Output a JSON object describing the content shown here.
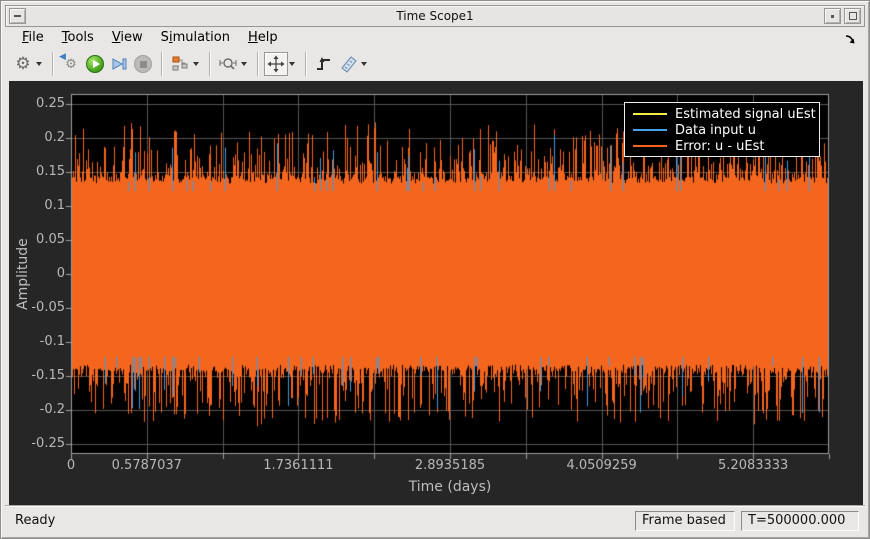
{
  "window": {
    "title": "Time Scope1"
  },
  "menubar": {
    "items": [
      {
        "pre": "",
        "mn": "F",
        "post": "ile"
      },
      {
        "pre": "",
        "mn": "T",
        "post": "ools"
      },
      {
        "pre": "",
        "mn": "V",
        "post": "iew"
      },
      {
        "pre": "S",
        "mn": "i",
        "post": "mulation"
      },
      {
        "pre": "",
        "mn": "H",
        "post": "elp"
      }
    ]
  },
  "toolbar": {
    "buttons": [
      "settings-gear",
      "connect-to-simulink",
      "run",
      "step-forward",
      "stop",
      "signal-selector",
      "zoom",
      "span-axes",
      "trigger",
      "measurements"
    ]
  },
  "chart_data": {
    "type": "line",
    "title": "",
    "xlabel": "Time (days)",
    "ylabel": "Amplitude",
    "xlim": [
      0,
      5.787037
    ],
    "ylim": [
      -0.2647,
      0.2647
    ],
    "grid": true,
    "background": "#000000",
    "grid_color": "#565656",
    "axis_color": "#9e9e9e",
    "tick_label_color": "#b8b8b8",
    "xticks": {
      "gridline_step": 0.5787037,
      "labels": [
        {
          "value": 0,
          "text": "0"
        },
        {
          "value": 0.5787037,
          "text": "0.5787037"
        },
        {
          "value": 1.7361111,
          "text": "1.7361111"
        },
        {
          "value": 2.8935185,
          "text": "2.8935185"
        },
        {
          "value": 4.0509259,
          "text": "4.0509259"
        },
        {
          "value": 5.2083333,
          "text": "5.2083333"
        }
      ]
    },
    "yticks": [
      {
        "value": 0.25,
        "text": "0.25"
      },
      {
        "value": 0.2,
        "text": "0.2"
      },
      {
        "value": 0.15,
        "text": "0.15"
      },
      {
        "value": 0.1,
        "text": "0.1"
      },
      {
        "value": 0.05,
        "text": "0.05"
      },
      {
        "value": 0,
        "text": "0"
      },
      {
        "value": -0.05,
        "text": "-0.05"
      },
      {
        "value": -0.1,
        "text": "-0.1"
      },
      {
        "value": -0.15,
        "text": "-0.15"
      },
      {
        "value": -0.2,
        "text": "-0.2"
      },
      {
        "value": -0.25,
        "text": "-0.25"
      }
    ],
    "legend": {
      "position": "northeast",
      "entries": [
        {
          "label": "Estimated signal uEst",
          "color": "#f2ee45"
        },
        {
          "label": "Data input u",
          "color": "#4aa0e8"
        },
        {
          "label": "Error: u - uEst",
          "color": "#f4661e"
        }
      ]
    },
    "series": [
      {
        "name": "Estimated signal uEst",
        "color": "#f2ee45",
        "description": "hidden beneath dense error trace"
      },
      {
        "name": "Data input u",
        "color": "#4499e0",
        "description": "sparse spikes protruding to about ±0.2"
      },
      {
        "name": "Error: u - uEst",
        "color": "#f4661e",
        "description": "dense noise band",
        "solid_band": [
          -0.131,
          0.131
        ],
        "spike_extent": [
          -0.22,
          0.22
        ]
      }
    ],
    "noise": {
      "seed": 1337,
      "core": 0.129,
      "base_jitter": 0.01,
      "spike_amp": 0.082,
      "spike_exp": 3,
      "blue_count": 70,
      "blue_base": 0.135,
      "blue_amp": 0.07
    }
  },
  "statusbar": {
    "ready": "Ready",
    "frame_mode": "Frame based",
    "time": "T=500000.000"
  }
}
